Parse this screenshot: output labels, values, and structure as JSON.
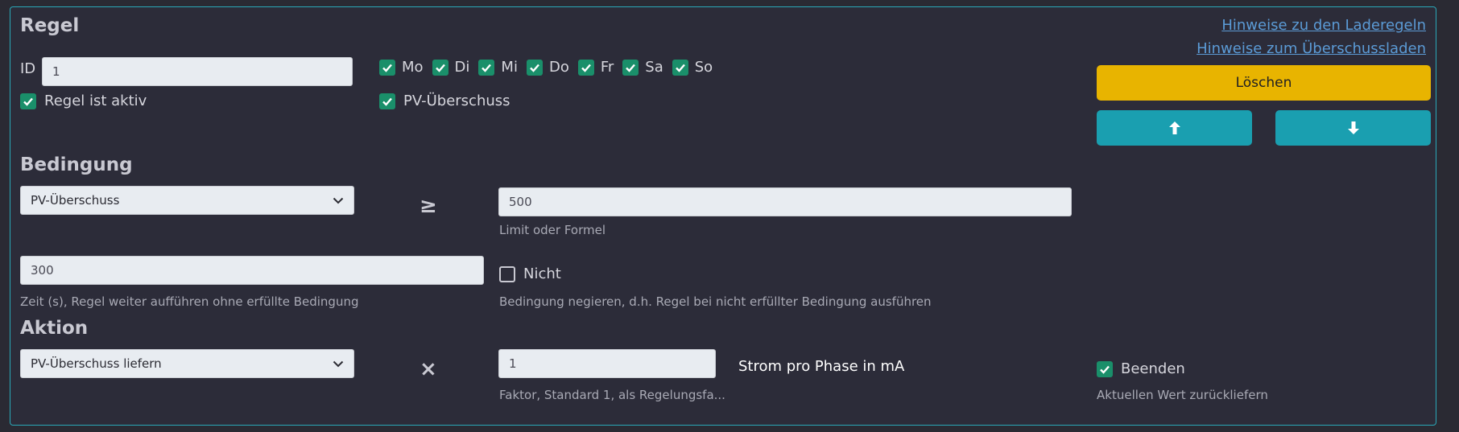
{
  "regel": {
    "title": "Regel",
    "links": [
      "Hinweise zu den Laderegeln",
      "Hinweise zum Überschussladen"
    ],
    "id_label": "ID",
    "id_value": "1",
    "days": [
      {
        "label": "Mo",
        "checked": true
      },
      {
        "label": "Di",
        "checked": true
      },
      {
        "label": "Mi",
        "checked": true
      },
      {
        "label": "Do",
        "checked": true
      },
      {
        "label": "Fr",
        "checked": true
      },
      {
        "label": "Sa",
        "checked": true
      },
      {
        "label": "So",
        "checked": true
      }
    ],
    "active_label": "Regel ist aktiv",
    "active_checked": true,
    "pv_label": "PV-Überschuss",
    "pv_checked": true,
    "delete_label": "Löschen"
  },
  "bedingung": {
    "title": "Bedingung",
    "type_selected": "PV-Überschuss",
    "operator": "≥",
    "limit_value": "500",
    "limit_help": "Limit oder Formel",
    "time_value": "300",
    "time_help": "Zeit (s), Regel weiter aufführen ohne erfüllte Bedingung",
    "not_label": "Nicht",
    "not_checked": false,
    "not_help": "Bedingung negieren, d.h. Regel bei nicht erfüllter Bedingung ausführen"
  },
  "aktion": {
    "title": "Aktion",
    "type_selected": "PV-Überschuss liefern",
    "operator": "×",
    "factor_value": "1",
    "factor_help": "Faktor, Standard 1, als Regelungsfa...",
    "unit_label": "Strom pro Phase in mA",
    "end_label": "Beenden",
    "end_checked": true,
    "end_help": "Aktuellen Wert zurückliefern"
  },
  "colors": {
    "accent_border": "#2aa8b8",
    "delete_button": "#e8b400",
    "arrow_buttons": "#1a9fb0",
    "checkbox": "#1a8f6a"
  },
  "icons": {
    "up": "arrow-up-icon",
    "down": "arrow-down-icon",
    "check": "check-icon",
    "chevron": "chevron-down-icon"
  }
}
